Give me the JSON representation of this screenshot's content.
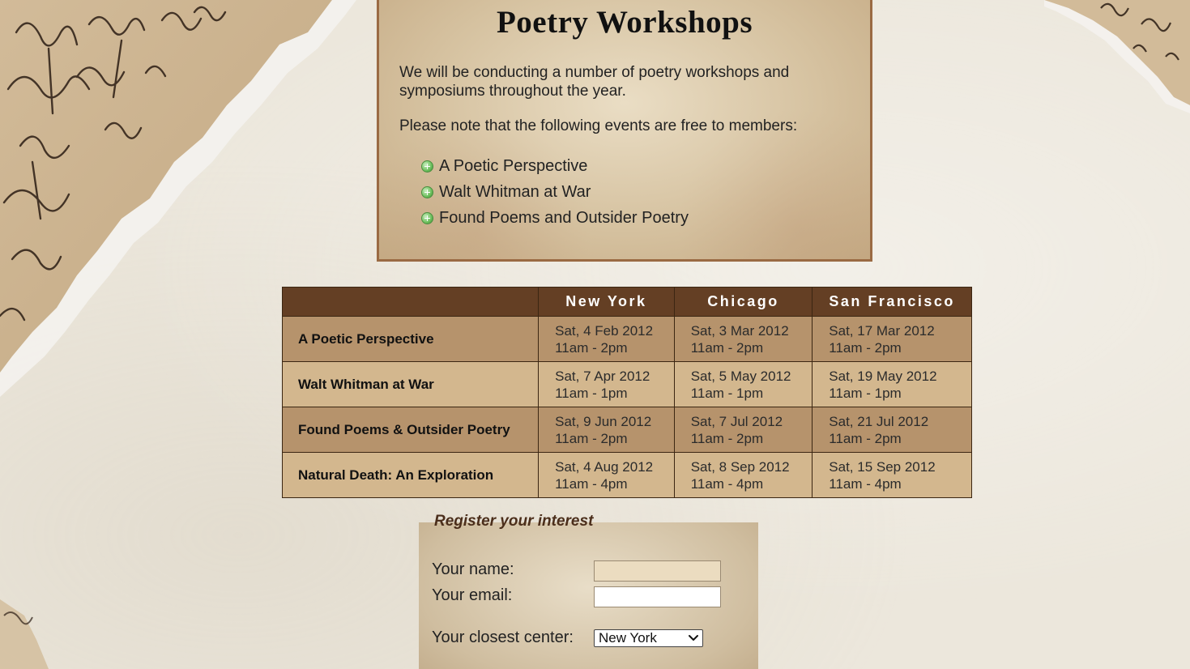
{
  "intro": {
    "title": "Poetry Workshops",
    "paragraph1": "We will be conducting a number of poetry workshops and symposiums throughout the year.",
    "paragraph2": "Please note that the following events are free to members:",
    "free_events": [
      "A Poetic Perspective",
      "Walt Whitman at War",
      "Found Poems and Outsider Poetry"
    ]
  },
  "schedule": {
    "columns": [
      "",
      "New York",
      "Chicago",
      "San Francisco"
    ],
    "rows": [
      {
        "event": "A Poetic Perspective",
        "cells": [
          {
            "date": "Sat, 4 Feb 2012",
            "time": "11am - 2pm"
          },
          {
            "date": "Sat, 3 Mar 2012",
            "time": "11am - 2pm"
          },
          {
            "date": "Sat, 17 Mar 2012",
            "time": "11am - 2pm"
          }
        ]
      },
      {
        "event": "Walt Whitman at War",
        "cells": [
          {
            "date": "Sat, 7 Apr 2012",
            "time": "11am - 1pm"
          },
          {
            "date": "Sat, 5 May 2012",
            "time": "11am - 1pm"
          },
          {
            "date": "Sat, 19 May 2012",
            "time": "11am - 1pm"
          }
        ]
      },
      {
        "event": "Found Poems & Outsider Poetry",
        "cells": [
          {
            "date": "Sat, 9 Jun 2012",
            "time": "11am - 2pm"
          },
          {
            "date": "Sat, 7 Jul 2012",
            "time": "11am - 2pm"
          },
          {
            "date": "Sat, 21 Jul 2012",
            "time": "11am - 2pm"
          }
        ]
      },
      {
        "event": "Natural Death: An Exploration",
        "cells": [
          {
            "date": "Sat, 4 Aug 2012",
            "time": "11am - 4pm"
          },
          {
            "date": "Sat, 8 Sep 2012",
            "time": "11am - 4pm"
          },
          {
            "date": "Sat, 15 Sep 2012",
            "time": "11am - 4pm"
          }
        ]
      }
    ]
  },
  "register": {
    "legend": "Register your interest",
    "name_label": "Your name:",
    "name_value": "",
    "email_label": "Your email:",
    "email_value": "",
    "center_label": "Your closest center:",
    "center_selected": "New York"
  },
  "colors": {
    "table_header": "#643f24",
    "row_dark": "#b6936c",
    "row_light": "#d3b78e",
    "legend_text": "#4b2e1b",
    "bullet": "#6cbf5c"
  },
  "icons": {
    "bullet": "plus-circle-icon",
    "select": "chevron-down-icon"
  }
}
